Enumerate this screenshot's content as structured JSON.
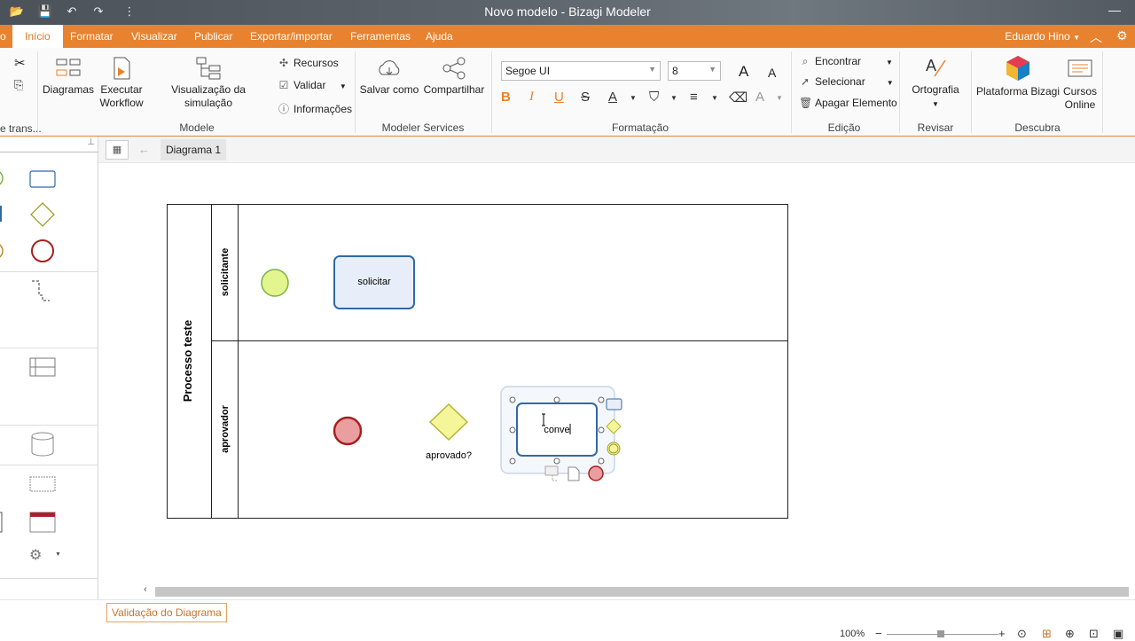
{
  "window": {
    "title": "Novo modelo - Bizagi Modeler"
  },
  "quick_access": {
    "overflow": "⋮"
  },
  "menu": {
    "file_stub": "o",
    "tabs": [
      "Início",
      "Formatar",
      "Visualizar",
      "Publicar",
      "Exportar/importar",
      "Ferramentas",
      "Ajuda"
    ],
    "user": "Eduardo Hino"
  },
  "ribbon": {
    "clipboard_label": "e trans...",
    "modele": {
      "diagramas": "Diagramas",
      "executar_1": "Executar",
      "executar_2": "Workflow",
      "simulacao": "Visualização da simulação",
      "recursos": "Recursos",
      "validar": "Validar",
      "informacoes": "Informações",
      "group": "Modele"
    },
    "services": {
      "salvar": "Salvar como",
      "compartilhar": "Compartilhar",
      "group": "Modeler Services"
    },
    "formatacao": {
      "font": "Segoe UI",
      "size": "8",
      "group": "Formatação"
    },
    "edicao": {
      "encontrar": "Encontrar",
      "selecionar": "Selecionar",
      "apagar": "Apagar Elemento",
      "group": "Edição"
    },
    "revisar": {
      "ortografia": "Ortografia",
      "group": "Revisar"
    },
    "descubra": {
      "plataforma": "Plataforma Bizagi",
      "cursos_1": "Cursos",
      "cursos_2": "Online",
      "group": "Descubra"
    }
  },
  "doc_tabs": {
    "active": "Diagrama 1"
  },
  "diagram": {
    "pool": "Processo teste",
    "lanes": [
      "solicitante",
      "aprovador"
    ],
    "task_solicitar": "solicitar",
    "gateway_label": "aprovado?",
    "editing_text": "conve"
  },
  "colors": {
    "accent": "#e8822e",
    "start_event": "#e2f58f",
    "end_event": "#e99ea0",
    "task_fill": "#e8eef9",
    "task_border": "#2f6aa5",
    "gateway": "#f5f59a"
  },
  "status": {
    "validation_tab": "Validação do Diagrama",
    "zoom": "100%"
  }
}
